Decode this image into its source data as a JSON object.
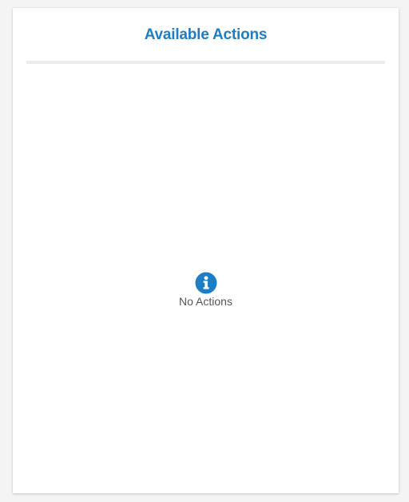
{
  "panel": {
    "title": "Available Actions",
    "empty_message": "No Actions",
    "empty_icon": "info-icon"
  },
  "colors": {
    "accent": "#1d7ec3",
    "text_muted": "#555555",
    "divider": "#ebebeb"
  }
}
